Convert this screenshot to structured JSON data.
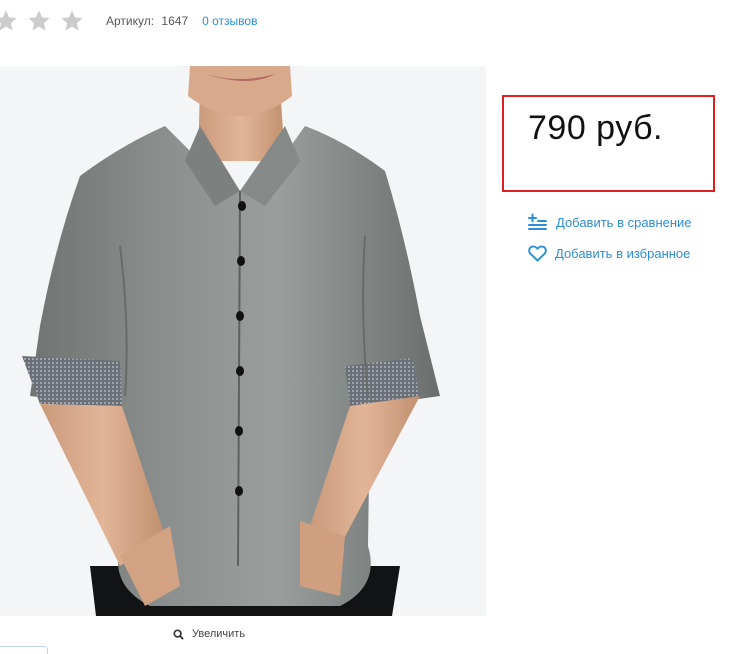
{
  "rating": {
    "stars_filled": 0,
    "stars_total": 3
  },
  "product": {
    "sku_label": "Артикул:",
    "sku_value": "1647",
    "reviews_link": "0 отзывов",
    "price": "790 руб."
  },
  "actions": {
    "compare": "Добавить в сравнение",
    "favorite": "Добавить в избранное"
  },
  "gallery": {
    "zoom_label": "Увеличить"
  },
  "colors": {
    "accent": "#2d8ed6",
    "highlight_border": "#e02020",
    "star_empty": "#cccccc"
  }
}
